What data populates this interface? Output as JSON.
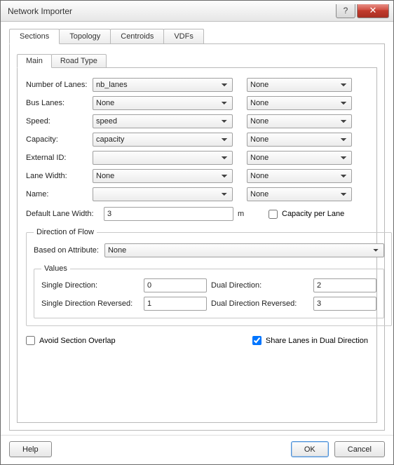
{
  "window": {
    "title": "Network Importer"
  },
  "tabs": {
    "sections": "Sections",
    "topology": "Topology",
    "centroids": "Centroids",
    "vdfs": "VDFs"
  },
  "subtabs": {
    "main": "Main",
    "road_type": "Road Type"
  },
  "labels": {
    "number_of_lanes": "Number of Lanes:",
    "bus_lanes": "Bus Lanes:",
    "speed": "Speed:",
    "capacity": "Capacity:",
    "external_id": "External ID:",
    "lane_width": "Lane Width:",
    "name": "Name:",
    "default_lane_width": "Default Lane Width:",
    "unit_m": "m",
    "capacity_per_lane": "Capacity per Lane",
    "direction_of_flow": "Direction of Flow",
    "based_on_attribute": "Based on Attribute:",
    "values": "Values",
    "single_direction": "Single Direction:",
    "dual_direction": "Dual Direction:",
    "single_direction_reversed": "Single Direction Reversed:",
    "dual_direction_reversed": "Dual Direction Reversed:",
    "avoid_section_overlap": "Avoid Section Overlap",
    "share_lanes": "Share Lanes in Dual Direction"
  },
  "values": {
    "number_of_lanes_a": "nb_lanes",
    "number_of_lanes_b": "None",
    "bus_lanes_a": "None",
    "bus_lanes_b": "None",
    "speed_a": "speed",
    "speed_b": "None",
    "capacity_a": "capacity",
    "capacity_b": "None",
    "external_id_a": "",
    "external_id_b": "None",
    "lane_width_a": "None",
    "lane_width_b": "None",
    "name_a": "",
    "name_b": "None",
    "default_lane_width": "3",
    "capacity_per_lane_checked": false,
    "based_on_attribute": "None",
    "single_direction": "0",
    "dual_direction": "2",
    "single_direction_reversed": "1",
    "dual_direction_reversed": "3",
    "avoid_section_overlap_checked": false,
    "share_lanes_checked": true
  },
  "buttons": {
    "help": "Help",
    "ok": "OK",
    "cancel": "Cancel"
  }
}
